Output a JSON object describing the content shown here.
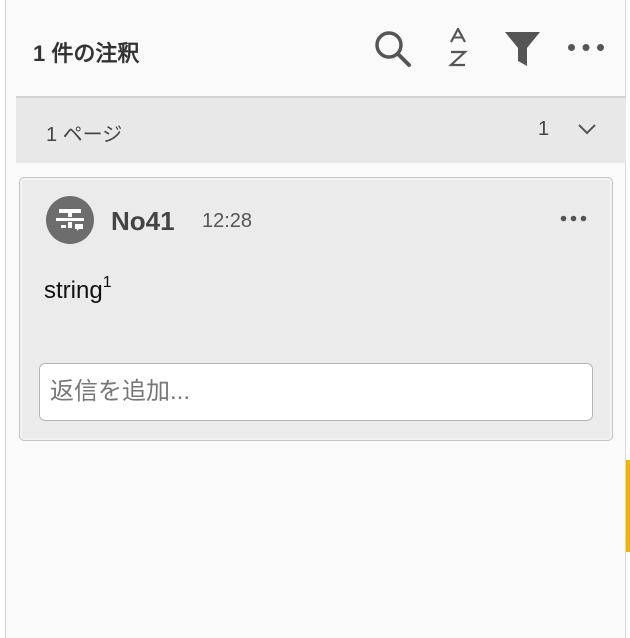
{
  "header": {
    "title": "1 件の注釈",
    "icons": [
      "search-icon",
      "sort-az-icon",
      "filter-icon",
      "more-icon"
    ]
  },
  "page_group": {
    "label": "1 ページ",
    "count": "1",
    "icon": "chevron-down-icon"
  },
  "comment": {
    "author": "No41",
    "time": "12:28",
    "text": "string",
    "superscript": "1",
    "avatar_icon": "strikethrough-text-icon",
    "menu_icon": "more-icon"
  },
  "reply": {
    "placeholder": "返信を追加..."
  },
  "colors": {
    "panel_bg": "#fafafa",
    "page_bar_bg": "#e8e8e8",
    "card_bg": "#ebebeb",
    "avatar": "#6d6d6d",
    "highlight": "#f2b400"
  }
}
